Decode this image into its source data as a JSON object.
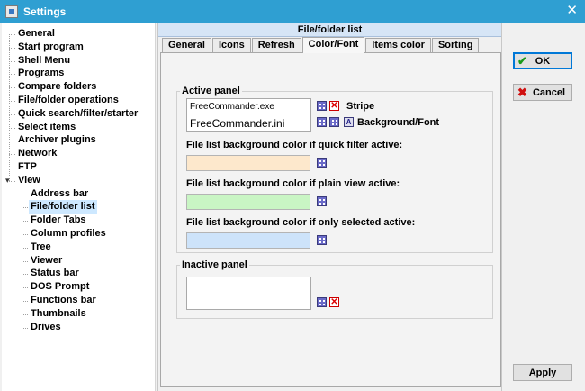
{
  "window": {
    "title": "Settings",
    "close_glyph": "✕"
  },
  "tree": {
    "items": [
      {
        "label": "General",
        "level": 0
      },
      {
        "label": "Start program",
        "level": 0
      },
      {
        "label": "Shell Menu",
        "level": 0
      },
      {
        "label": "Programs",
        "level": 0
      },
      {
        "label": "Compare folders",
        "level": 0
      },
      {
        "label": "File/folder operations",
        "level": 0
      },
      {
        "label": "Quick search/filter/starter",
        "level": 0
      },
      {
        "label": "Select items",
        "level": 0
      },
      {
        "label": "Archiver plugins",
        "level": 0
      },
      {
        "label": "Network",
        "level": 0
      },
      {
        "label": "FTP",
        "level": 0
      },
      {
        "label": "View",
        "level": 0
      },
      {
        "label": "Address bar",
        "level": 1
      },
      {
        "label": "File/folder list",
        "level": 1
      },
      {
        "label": "Folder Tabs",
        "level": 1
      },
      {
        "label": "Column profiles",
        "level": 1
      },
      {
        "label": "Tree",
        "level": 1
      },
      {
        "label": "Viewer",
        "level": 1
      },
      {
        "label": "Status bar",
        "level": 1
      },
      {
        "label": "DOS Prompt",
        "level": 1
      },
      {
        "label": "Functions bar",
        "level": 1
      },
      {
        "label": "Thumbnails",
        "level": 1
      },
      {
        "label": "Drives",
        "level": 1
      }
    ],
    "selected": "File/folder list",
    "expander_glyph": "▾"
  },
  "panel": {
    "header": "File/folder list",
    "tabs": [
      "General",
      "Icons",
      "Refresh",
      "Color/Font",
      "Items color",
      "Sorting"
    ],
    "active_tab": "Color/Font",
    "active_panel": {
      "label": "Active panel",
      "list_row_1": "FreeCommander.exe",
      "list_row_2": "FreeCommander.ini",
      "stripe_label": "Stripe",
      "bg_font_label": "Background/Font",
      "quick_filter_label": "File list background color if quick filter active:",
      "quick_filter_color": "#fde8cc",
      "plain_view_label": "File list background color if plain view active:",
      "plain_view_color": "#c9f5c4",
      "only_selected_label": "File list background color if only selected active:",
      "only_selected_color": "#cde3fa"
    },
    "inactive_panel": {
      "label": "Inactive panel"
    },
    "font_icon_glyph": "A",
    "remove_icon_glyph": "✕"
  },
  "buttons": {
    "ok": "OK",
    "ok_icon": "✔",
    "cancel": "Cancel",
    "cancel_icon": "✖",
    "apply": "Apply"
  },
  "colors": {
    "titlebar": "#2f9fd2",
    "selected_item": "#cde8ff",
    "panel_header": "#d6e5f6"
  }
}
